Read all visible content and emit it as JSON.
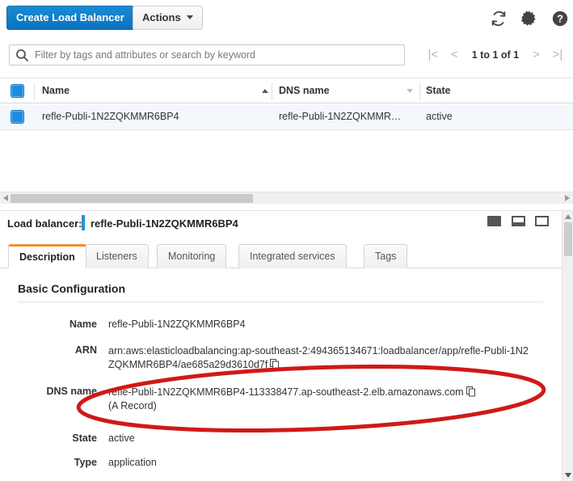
{
  "toolbar": {
    "create_label": "Create Load Balancer",
    "actions_label": "Actions",
    "refresh_icon": "refresh-icon",
    "settings_icon": "gear-icon",
    "help_icon": "help-icon"
  },
  "filter": {
    "placeholder": "Filter by tags and attributes or search by keyword",
    "value": "",
    "search_icon": "search-icon"
  },
  "pagination": {
    "first_label": "|<",
    "prev_label": "<",
    "range_label": "1 to 1 of 1",
    "next_label": ">",
    "last_label": ">|"
  },
  "table": {
    "columns": [
      {
        "label": "Name",
        "sort": "asc"
      },
      {
        "label": "DNS name",
        "sort": "desc"
      },
      {
        "label": "State",
        "sort": "none"
      }
    ],
    "rows": [
      {
        "selected": true,
        "name": "refle-Publi-1N2ZQKMMR6BP4",
        "dns_name": "refle-Publi-1N2ZQKMMR…",
        "state": "active"
      }
    ]
  },
  "detail": {
    "header_label": "Load balancer:",
    "header_value": "refle-Publi-1N2ZQKMMR6BP4",
    "size_icons": [
      "panel-size-small-icon",
      "panel-size-medium-icon",
      "panel-size-large-icon"
    ],
    "tabs": [
      {
        "label": "Description",
        "active": true
      },
      {
        "label": "Listeners",
        "active": false
      },
      {
        "label": "Monitoring",
        "active": false
      },
      {
        "label": "Integrated services",
        "active": false
      },
      {
        "label": "Tags",
        "active": false
      }
    ],
    "section_title": "Basic Configuration",
    "fields": [
      {
        "label": "Name",
        "value": "refle-Publi-1N2ZQKMMR6BP4"
      },
      {
        "label": "ARN",
        "value": "arn:aws:elasticloadbalancing:ap-southeast-2:494365134671:loadbalancer/app/refle-Publi-1N2ZQKMMR6BP4/ae685a29d3610d7f"
      },
      {
        "label": "DNS name",
        "value": "refle-Publi-1N2ZQKMMR6BP4-113338477.ap-southeast-2.elb.amazonaws.com"
      },
      {
        "label": "",
        "value": "(A Record)"
      },
      {
        "label": "State",
        "value": "active"
      },
      {
        "label": "Type",
        "value": "application"
      }
    ]
  },
  "annotation": {
    "shape": "ellipse",
    "color": "#d01919",
    "target": "dns-name-field"
  },
  "colors": {
    "primary_button": "#0a72c0",
    "accent_tab": "#ec912d",
    "checkbox": "#1f8ce0",
    "row_selected": "#f4f8fd",
    "annotation_red": "#d01919"
  }
}
